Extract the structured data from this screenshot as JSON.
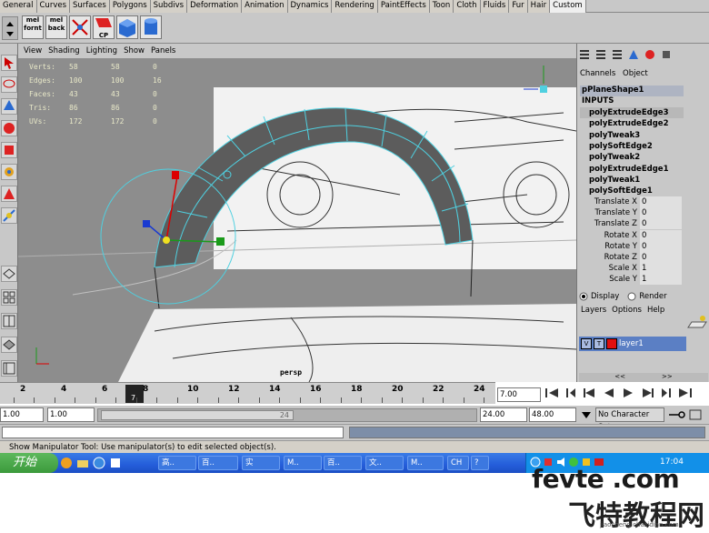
{
  "shelf_tabs": [
    "General",
    "Curves",
    "Surfaces",
    "Polygons",
    "Subdivs",
    "Deformation",
    "Animation",
    "Dynamics",
    "Rendering",
    "PaintEffects",
    "Toon",
    "Cloth",
    "Fluids",
    "Fur",
    "Hair",
    "Custom"
  ],
  "shelf_buttons": [
    {
      "label": "mel\nfornt",
      "icon": "mel-script-icon"
    },
    {
      "label": "mel\nback",
      "icon": "mel-script-icon"
    },
    {
      "label": "",
      "icon": "xyz-node-icon"
    },
    {
      "label": "CP",
      "icon": "copy-pivot-icon"
    },
    {
      "label": "",
      "icon": "cube-icon"
    },
    {
      "label": "",
      "icon": "cylinder-icon"
    }
  ],
  "view_menu": [
    "View",
    "Shading",
    "Lighting",
    "Show",
    "Panels"
  ],
  "hud": {
    "rows": [
      {
        "label": "Verts:",
        "a": "58",
        "b": "58",
        "c": "0"
      },
      {
        "label": "Edges:",
        "a": "100",
        "b": "100",
        "c": "16"
      },
      {
        "label": "Faces:",
        "a": "43",
        "b": "43",
        "c": "0"
      },
      {
        "label": "Tris:",
        "a": "86",
        "b": "86",
        "c": "0"
      },
      {
        "label": "UVs:",
        "a": "172",
        "b": "172",
        "c": "0"
      }
    ],
    "camera": "persp"
  },
  "channel_box": {
    "menu": [
      "Channels",
      "Object"
    ],
    "node": "pPlaneShape1",
    "inputs_header": "INPUTS",
    "inputs": [
      "polyExtrudeEdge3",
      "polyExtrudeEdge2",
      "polyTweak3",
      "polySoftEdge2",
      "polyTweak2",
      "polyExtrudeEdge1",
      "polyTweak1",
      "polySoftEdge1"
    ],
    "attributes": [
      {
        "name": "Translate X",
        "value": "0"
      },
      {
        "name": "Translate Y",
        "value": "0"
      },
      {
        "name": "Translate Z",
        "value": "0"
      },
      {
        "name": "Rotate X",
        "value": "0"
      },
      {
        "name": "Rotate Y",
        "value": "0"
      },
      {
        "name": "Rotate Z",
        "value": "0"
      },
      {
        "name": "Scale X",
        "value": "1"
      },
      {
        "name": "Scale Y",
        "value": "1"
      }
    ]
  },
  "layer_editor": {
    "display_label": "Display",
    "render_label": "Render",
    "menu": [
      "Layers",
      "Options",
      "Help"
    ],
    "layer_v": "V",
    "layer_t": "T",
    "layer_name": "layer1"
  },
  "timeline": {
    "ticks": [
      "2",
      "4",
      "6",
      "8",
      "10",
      "12",
      "14",
      "16",
      "18",
      "20",
      "22",
      "24"
    ],
    "current_frame": "7",
    "current_time_field": "7.00"
  },
  "range": {
    "start": "1.00",
    "playback_start": "1.00",
    "slider_end": "24",
    "playback_end": "24.00",
    "end": "48.00",
    "character_set": "No Character Set"
  },
  "help_line": "Show Manipulator Tool: Use manipulator(s) to edit selected object(s).",
  "taskbar": {
    "start_label": "开始",
    "tasks": [
      "高..",
      "百..",
      "实",
      "M..",
      "百..",
      "文..",
      "M..",
      "CH",
      "?"
    ],
    "clock": "17:04"
  },
  "watermark": {
    "line1": "fevte .com",
    "line2": "飞特教程网",
    "line3": "jiaocheng.chazidian.com"
  },
  "colors": {
    "ui_gray": "#c8c8c8",
    "viewport": "#8d8d8d",
    "wire_cyan": "#4fd0e0",
    "selected_node": "#aeb4c2",
    "taskbar_blue": "#245dda"
  }
}
